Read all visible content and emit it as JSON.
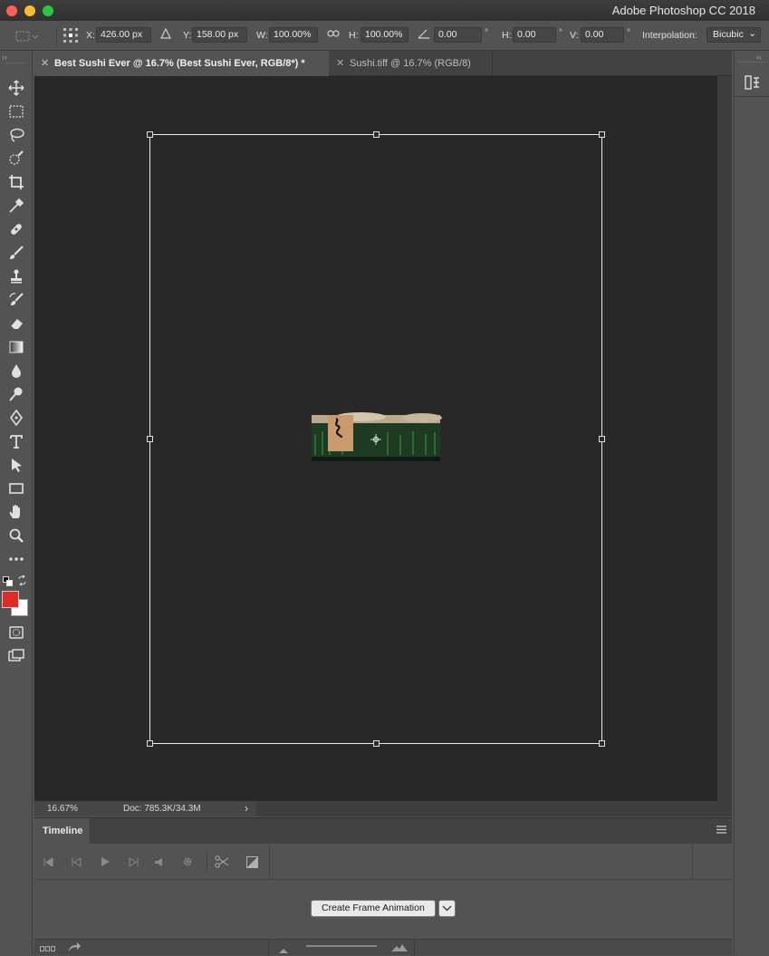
{
  "window": {
    "title": "Adobe Photoshop CC 2018"
  },
  "options_bar": {
    "x_label": "X:",
    "x_value": "426.00 px",
    "y_label": "Y:",
    "y_value": "158.00 px",
    "w_label": "W:",
    "w_value": "100.00%",
    "h_label": "H:",
    "h_value": "100.00%",
    "rotate_value": "0.00",
    "rotate_unit": "°",
    "hskew_label": "H:",
    "hskew_value": "0.00",
    "hskew_unit": "°",
    "vskew_label": "V:",
    "vskew_value": "0.00",
    "vskew_unit": "°",
    "interpolation_label": "Interpolation:",
    "interpolation_value": "Bicubic"
  },
  "tabs": [
    {
      "label": "Best Sushi Ever @ 16.7% (Best Sushi Ever, RGB/8*) *",
      "active": true
    },
    {
      "label": "Sushi.tiff @ 16.7% (RGB/8)",
      "active": false
    }
  ],
  "toolbox": {
    "icons": [
      "move-icon",
      "marquee-icon",
      "lasso-icon",
      "quick-select-icon",
      "crop-icon",
      "eyedropper-icon",
      "healing-brush-icon",
      "brush-icon",
      "clone-stamp-icon",
      "history-brush-icon",
      "eraser-icon",
      "gradient-icon",
      "blur-icon",
      "dodge-icon",
      "pen-icon",
      "type-icon",
      "path-select-icon",
      "rectangle-icon",
      "hand-icon",
      "zoom-icon",
      "more-tools-icon"
    ],
    "foreground_color": "#e02a2a",
    "background_color": "#ffffff"
  },
  "status": {
    "zoom": "16.67%",
    "doc": "Doc: 785.3K/34.3M"
  },
  "timeline": {
    "title": "Timeline",
    "create_button": "Create Frame Animation"
  },
  "colors": {
    "canvas_bg": "#282828",
    "ui_bg": "#535353",
    "transform_box": "#e8e8e8"
  }
}
